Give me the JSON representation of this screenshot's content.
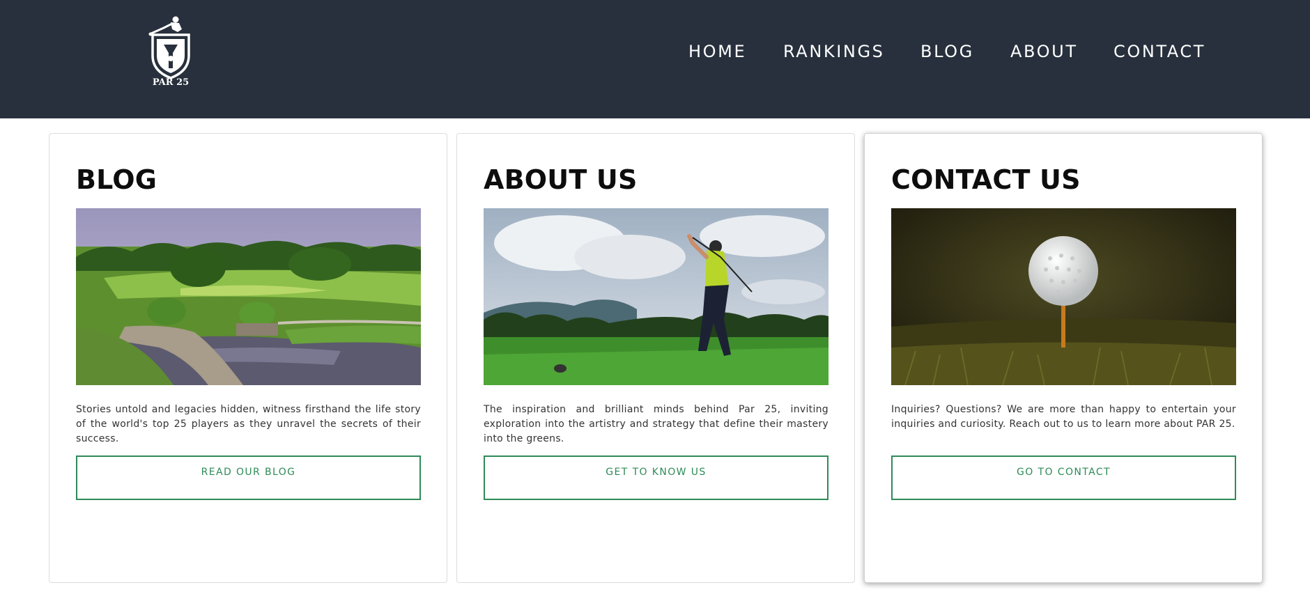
{
  "brand": {
    "logo_text": "PAR 25"
  },
  "nav": {
    "items": [
      {
        "label": "HOME"
      },
      {
        "label": "RANKINGS"
      },
      {
        "label": "BLOG"
      },
      {
        "label": "ABOUT"
      },
      {
        "label": "CONTACT"
      }
    ]
  },
  "cards": [
    {
      "title": "BLOG",
      "image": "golf-course-landscape",
      "text": "Stories untold and legacies hidden, witness firsthand the life story of the world's top 25 players as they unravel the secrets of their success.",
      "button": "READ OUR BLOG"
    },
    {
      "title": "ABOUT US",
      "image": "golfer-swinging",
      "text": "The inspiration and brilliant minds behind Par 25, inviting exploration into the artistry and strategy that define their mastery into the greens.",
      "button": "GET TO KNOW US"
    },
    {
      "title": "CONTACT US",
      "image": "golf-ball-on-tee",
      "text": "Inquiries? Questions? We are more than happy to entertain your inquiries and curiosity. Reach out to us to learn more about PAR 25.",
      "button": "GO TO CONTACT"
    }
  ],
  "colors": {
    "header_bg": "#27303c",
    "accent": "#2e8b57",
    "nav_text": "#ffffff"
  }
}
